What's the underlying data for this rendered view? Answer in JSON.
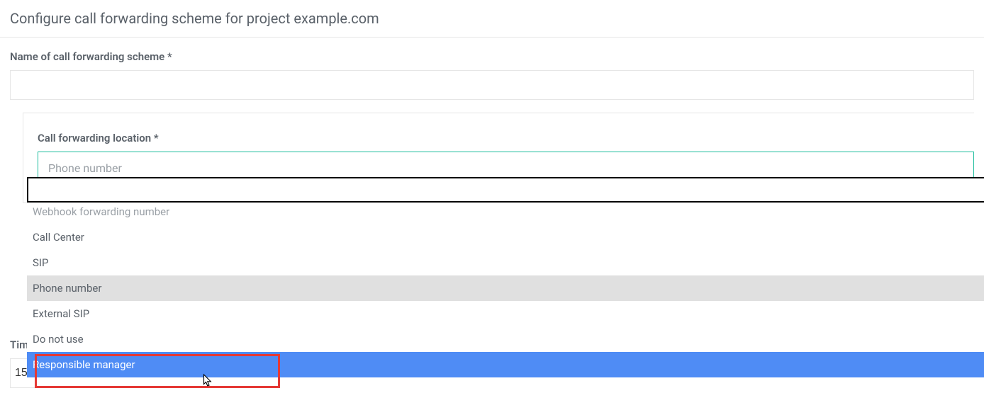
{
  "page": {
    "title": "Configure call forwarding scheme for project example.com"
  },
  "scheme_name": {
    "label": "Name of call forwarding scheme *",
    "value": ""
  },
  "location": {
    "label": "Call forwarding location *",
    "selected_display": "Phone number",
    "search_value": "",
    "options": [
      "Webhook forwarding number",
      "Call Center",
      "SIP",
      "Phone number",
      "External SIP",
      "Do not use",
      "Responsible manager"
    ],
    "selected_index": 3,
    "hovered_index": 6
  },
  "timeout": {
    "label_visible": "Time",
    "value_visible": "15"
  }
}
